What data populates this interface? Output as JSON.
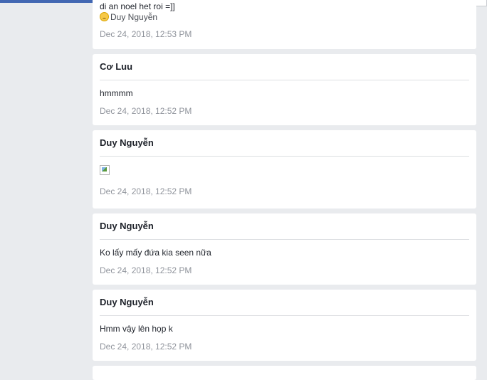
{
  "cards": [
    {
      "text_line": "di an noel het roi =]]",
      "signature": "Duy Nguyễn",
      "signature_icon": "sad-face-emoji-icon",
      "time": "Dec 24, 2018, 12:53 PM"
    },
    {
      "author": "Cơ Luu",
      "message": "hmmmm",
      "time": "Dec 24, 2018, 12:52 PM"
    },
    {
      "author": "Duy Nguyễn",
      "image_icon": "broken-image-icon",
      "time": "Dec 24, 2018, 12:52 PM"
    },
    {
      "author": "Duy Nguyễn",
      "message": "Ko lấy mấy đứa kia seen nữa",
      "time": "Dec 24, 2018, 12:52 PM"
    },
    {
      "author": "Duy Nguyễn",
      "message": "Hmm vậy lên họp k",
      "time": "Dec 24, 2018, 12:52 PM"
    }
  ],
  "colors": {
    "page_bg": "#e9ebee",
    "card_bg": "#ffffff",
    "author_text": "#1d2129",
    "timestamp_text": "#90949c",
    "top_bar": "#4267b2"
  }
}
